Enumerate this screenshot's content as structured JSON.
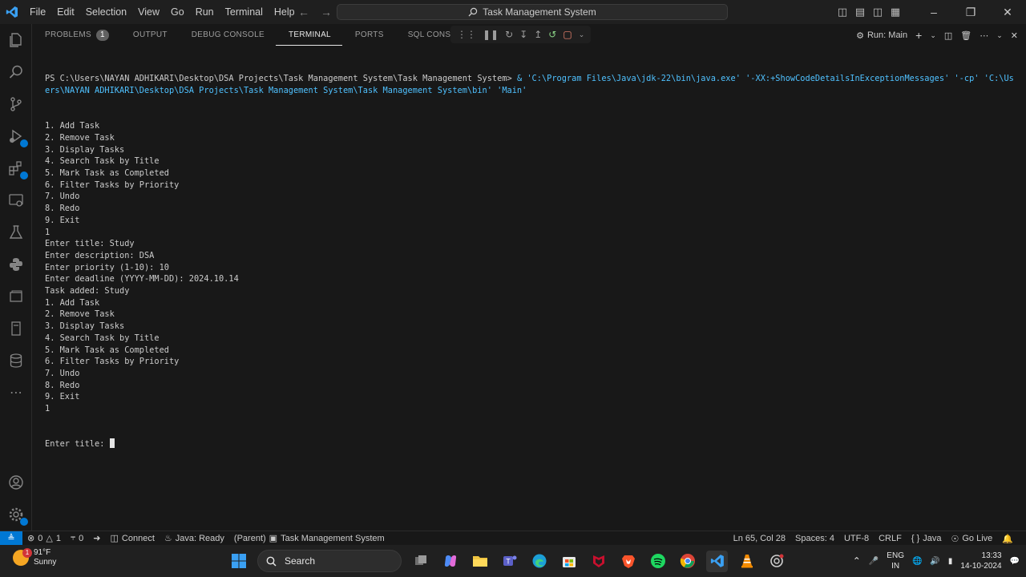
{
  "menu": [
    "File",
    "Edit",
    "Selection",
    "View",
    "Go",
    "Run",
    "Terminal",
    "Help"
  ],
  "window": {
    "title": "Task Management System"
  },
  "panel": {
    "tabs": [
      {
        "label": "PROBLEMS",
        "badge": "1"
      },
      {
        "label": "OUTPUT"
      },
      {
        "label": "DEBUG CONSOLE"
      },
      {
        "label": "TERMINAL"
      },
      {
        "label": "PORTS"
      },
      {
        "label": "SQL CONSOLE"
      }
    ],
    "run_label": "Run: Main"
  },
  "terminal": {
    "prompt": "PS C:\\Users\\NAYAN ADHIKARI\\Desktop\\DSA Projects\\Task Management System\\Task Management System> ",
    "command": " & 'C:\\Program Files\\Java\\jdk-22\\bin\\java.exe' '-XX:+ShowCodeDetailsInExceptionMessages' '-cp' 'C:\\Users\\NAYAN ADHIKARI\\Desktop\\DSA Projects\\Task Management System\\Task Management System\\bin' 'Main'",
    "lines": [
      "1. Add Task",
      "2. Remove Task",
      "3. Display Tasks",
      "4. Search Task by Title",
      "5. Mark Task as Completed",
      "6. Filter Tasks by Priority",
      "7. Undo",
      "8. Redo",
      "9. Exit",
      "1",
      "Enter title: Study",
      "Enter description: DSA",
      "Enter priority (1-10): 10",
      "Enter deadline (YYYY-MM-DD): 2024.10.14",
      "Task added: Study",
      "1. Add Task",
      "2. Remove Task",
      "3. Display Tasks",
      "4. Search Task by Title",
      "5. Mark Task as Completed",
      "6. Filter Tasks by Priority",
      "7. Undo",
      "8. Redo",
      "9. Exit",
      "1"
    ],
    "current_prompt": "Enter title: "
  },
  "statusbar": {
    "errors": "0",
    "warnings": "1",
    "ports": "0",
    "connect": "Connect",
    "java_status": "Java: Ready",
    "parent": "(Parent)",
    "project": "Task Management System",
    "position": "Ln 65, Col 28",
    "spaces": "Spaces: 4",
    "encoding": "UTF-8",
    "eol": "CRLF",
    "language": "Java",
    "golive": "Go Live"
  },
  "taskbar": {
    "weather_temp": "91°F",
    "weather_desc": "Sunny",
    "weather_badge": "1",
    "search_label": "Search",
    "lang_line1": "ENG",
    "lang_line2": "IN",
    "time": "13:33",
    "date": "14-10-2024"
  },
  "colors": {
    "accent": "#0078d4",
    "terminal_string": "#4fc1ff",
    "background": "#181818"
  }
}
